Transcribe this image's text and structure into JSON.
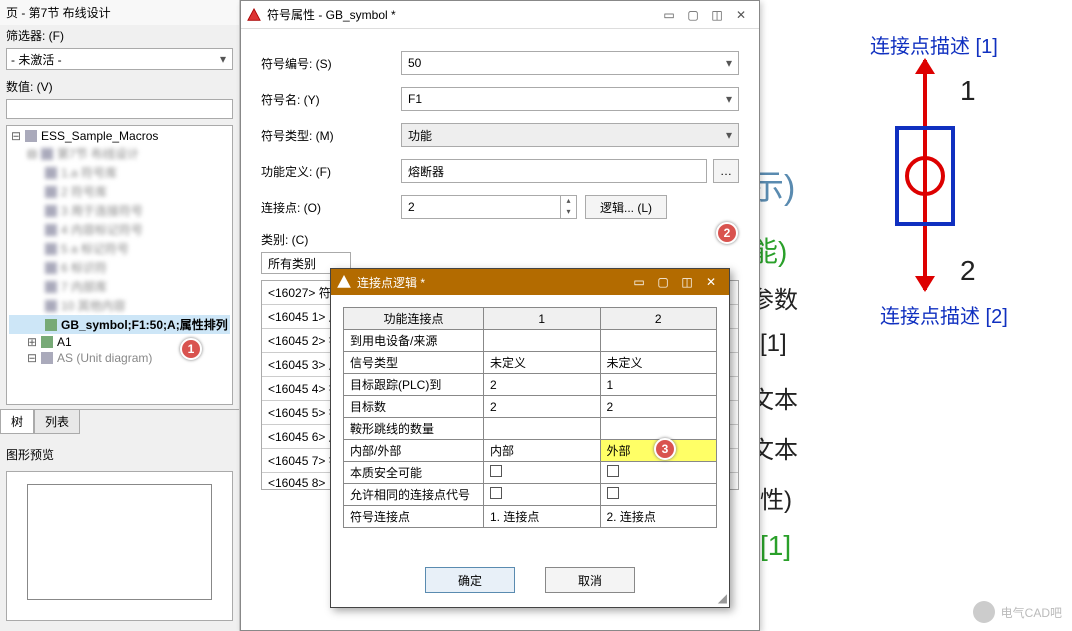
{
  "left": {
    "title": "页 - 第7节 布线设计",
    "filterLabel": "筛选器: (F)",
    "filterValue": "- 未激活 -",
    "valueLabel": "数值: (V)",
    "treeRoot": "ESS_Sample_Macros",
    "selected": "GB_symbol;F1:50;A;属性排列",
    "a1": "A1",
    "unit": "AS (Unit diagram)",
    "tabs": {
      "tree": "树",
      "list": "列表"
    },
    "previewLabel": "图形预览"
  },
  "dlg": {
    "title": "符号属性 - GB_symbol *",
    "rows": {
      "id": {
        "label": "符号编号: (S)",
        "value": "50"
      },
      "name": {
        "label": "符号名: (Y)",
        "value": "F1"
      },
      "type": {
        "label": "符号类型: (M)",
        "value": "功能"
      },
      "func": {
        "label": "功能定义: (F)",
        "value": "熔断器"
      },
      "conn": {
        "label": "连接点: (O)",
        "value": "2",
        "logic": "逻辑... (L)"
      },
      "cat": {
        "label": "类别: (C)",
        "value": "所有类别"
      }
    },
    "list": [
      "<16027> 符",
      "<16045 1> 属",
      "<16045 2> 符",
      "<16045 3> 属",
      "<16045 4> 符",
      "<16045 5> 符",
      "<16045 6> 属",
      "<16045 7> 符",
      "<16045 8>"
    ]
  },
  "sub": {
    "title": "连接点逻辑 *",
    "cols": {
      "fn": "功能连接点",
      "c1": "1",
      "c2": "2"
    },
    "rows": {
      "dev": "到用电设备/来源",
      "sig": {
        "label": "信号类型",
        "v1": "未定义",
        "v2": "未定义"
      },
      "plc": {
        "label": "目标跟踪(PLC)到",
        "v1": "2",
        "v2": "1"
      },
      "tgt": {
        "label": "目标数",
        "v1": "2",
        "v2": "2"
      },
      "saddle": "鞍形跳线的数量",
      "io": {
        "label": "内部/外部",
        "v1": "内部",
        "v2": "外部"
      },
      "safe": "本质安全可能",
      "same": "允许相同的连接点代号",
      "symc": {
        "label": "符号连接点",
        "v1": "1. 连接点",
        "v2": "2. 连接点"
      }
    },
    "ok": "确定",
    "cancel": "取消"
  },
  "canvas": {
    "desc1": "连接点描述 [1]",
    "desc2": "连接点描述 [2]",
    "p1": "1",
    "p2": "2",
    "hint1": "示)",
    "hint2": "能)",
    "side": {
      "a": "参数",
      "b": "[1]",
      "c": "文本",
      "d": "文本",
      "e": "性)",
      "f": "[1]"
    },
    "wm": "电气CAD吧"
  },
  "badges": {
    "b1": "1",
    "b2": "2",
    "b3": "3"
  }
}
